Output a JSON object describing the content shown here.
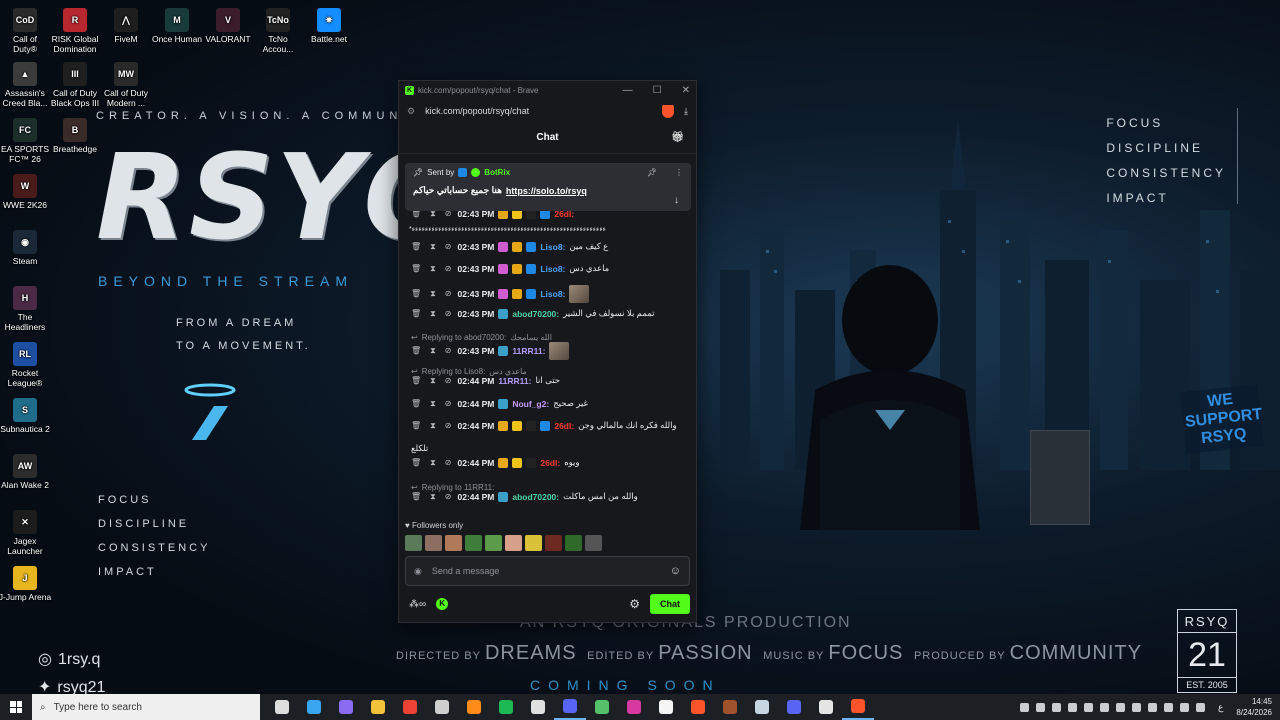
{
  "desktop": {
    "icons": [
      {
        "label": "Call of\nDuty®",
        "color": "#2b2b2b",
        "glyph": "CoD"
      },
      {
        "label": "RISK Global\nDomination",
        "color": "#b7282e",
        "glyph": "R"
      },
      {
        "label": "FiveM",
        "color": "#1e1e1e",
        "glyph": "⋀"
      },
      {
        "label": "Once Human",
        "color": "#173a3a",
        "glyph": "M"
      },
      {
        "label": "VALORANT",
        "color": "#3b1d2a",
        "glyph": "V"
      },
      {
        "label": "TcNo\nAccou...",
        "color": "#222",
        "glyph": "TcNo"
      },
      {
        "label": "Battle.net",
        "color": "#148eff",
        "glyph": "✷"
      },
      {
        "label": "Assassin's\nCreed Bla...",
        "color": "#3b3b3b",
        "glyph": "▲"
      },
      {
        "label": "Call of Duty\nBlack Ops III",
        "color": "#1f1f1f",
        "glyph": "III"
      },
      {
        "label": "Call of Duty\nModern ...",
        "color": "#2a2a2a",
        "glyph": "MW"
      },
      {
        "label": "EA SPORTS\nFC™ 26",
        "color": "#1c2f2a",
        "glyph": "FC"
      },
      {
        "label": "Breathedge",
        "color": "#3a2a28",
        "glyph": "B"
      },
      {
        "label": "WWE 2K26",
        "color": "#4a1b1b",
        "glyph": "W"
      },
      {
        "label": "Steam",
        "color": "#1b2838",
        "glyph": "◉"
      },
      {
        "label": "The\nHeadliners",
        "color": "#4a2a45",
        "glyph": "H"
      },
      {
        "label": "Rocket\nLeague®",
        "color": "#1d4fa3",
        "glyph": "RL"
      },
      {
        "label": "Subnautica 2",
        "color": "#1f6d8a",
        "glyph": "S"
      },
      {
        "label": "Alan Wake 2",
        "color": "#2c2c2c",
        "glyph": "AW"
      },
      {
        "label": "Jagex\nLauncher",
        "color": "#1c1c1c",
        "glyph": "✕"
      },
      {
        "label": "J-Jump Arena",
        "color": "#e7b51e",
        "glyph": "J"
      }
    ]
  },
  "wallpaper": {
    "tagline_top": "CREATOR. A VISION. A COMMUNITY",
    "logo": "RSYQ",
    "subtitle": "BEYOND THE STREAM",
    "dream_line1": "FROM A DREAM",
    "dream_line2": "TO A MOVEMENT.",
    "values": [
      "FOCUS",
      "DISCIPLINE",
      "CONSISTENCY",
      "IMPACT"
    ],
    "instagram": "1rsy.q",
    "twitter": "rsyq21",
    "production": "AN RSYQ ORIGINALS PRODUCTION",
    "credits": {
      "directed_label": "DIRECTED BY",
      "directed": "DREAMS",
      "edited_label": "EDITED BY",
      "edited": "PASSION",
      "music_label": "MUSIC BY",
      "music": "FOCUS",
      "produced_label": "PRODUCED BY",
      "produced": "COMMUNITY"
    },
    "coming_soon": "COMING SOON",
    "support_line1": "WE",
    "support_line2": "SUPPORT",
    "support_line3": "RSYQ",
    "badge_top": "RSYQ",
    "badge_num": "21",
    "badge_est": "EST. 2005"
  },
  "browser": {
    "title": "kick.com/popout/rsyq/chat - Brave",
    "url": "kick.com/popout/rsyq/chat",
    "minimize": "—",
    "maximize": "☐",
    "close": "✕"
  },
  "chat": {
    "header": "Chat",
    "pinned": {
      "sent_by": "Sent by",
      "user": "BotRix",
      "text": "هنا جميع حساباتي حياكم",
      "link": "https://solo.to/rsyq"
    },
    "messages": [
      {
        "time": "02:43 PM",
        "user": "26dl:",
        "user_color": "#ff3b30",
        "text": "",
        "badges": [
          "#e6a817",
          "#f0c419",
          "#222",
          "#1e88e5"
        ]
      },
      {
        "time": "02:43 PM",
        "user": "Liso8:",
        "user_color": "#4aa3ff",
        "text": "ع كيف مين",
        "badges": [
          "#d05cd0",
          "#e6a817",
          "#1e88e5"
        ]
      },
      {
        "time": "02:43 PM",
        "user": "Liso8:",
        "user_color": "#4aa3ff",
        "text": "ماعدي دس",
        "badges": [
          "#d05cd0",
          "#e6a817",
          "#1e88e5"
        ]
      },
      {
        "time": "02:43 PM",
        "user": "Liso8:",
        "user_color": "#4aa3ff",
        "text": "",
        "badges": [
          "#d05cd0",
          "#e6a817",
          "#1e88e5"
        ]
      },
      {
        "time": "02:43 PM",
        "user": "abod70200:",
        "user_color": "#4cd4a5",
        "text": "تممم بلا نسولف في الشير",
        "badges": [
          "#3aa0c8"
        ]
      },
      {
        "time": "02:43 PM",
        "user": "11RR11:",
        "user_color": "#b39dff",
        "text": "",
        "badges": [
          "#3aa0c8"
        ]
      },
      {
        "time": "02:44 PM",
        "user": "11RR11:",
        "user_color": "#b39dff",
        "text": "حتى انا",
        "badges": []
      },
      {
        "time": "02:44 PM",
        "user": "Nouf_g2:",
        "user_color": "#c89bff",
        "text": "غير صحيح",
        "badges": [
          "#3aa0c8"
        ]
      },
      {
        "time": "02:44 PM",
        "user": "26dl:",
        "user_color": "#ff3b30",
        "text": "والله فكره انك مالمالي وجن",
        "badges": [
          "#e6a817",
          "#f0c419",
          "#222",
          "#1e88e5"
        ]
      },
      {
        "time": "02:44 PM",
        "user": "26dl:",
        "user_color": "#ff3b30",
        "text": "ويوه",
        "badges": [
          "#e6a817",
          "#f0c419",
          "#222"
        ]
      },
      {
        "time": "02:44 PM",
        "user": "abod70200:",
        "user_color": "#4cd4a5",
        "text": "والله من امس ماكلت",
        "badges": [
          "#3aa0c8"
        ]
      }
    ],
    "spam_line": "*ءءءءءءءءءءءءءءءءءءءءءءءءءءءءءءءءءءءءءءءءءءءءءءءءءءءءءءءءءءء",
    "wrap_line": "تلكلع",
    "replies": {
      "r1": "Replying to abod70200:",
      "r1_text": "الله يسامحك",
      "r2": "Replying to Liso8:",
      "r2_text": "ماعدي دس",
      "r3": "Replying to 11RR11:"
    },
    "followers_only": "Followers only",
    "placeholder": "Send a message",
    "send_button": "Chat"
  },
  "taskbar": {
    "search_placeholder": "Type here to search",
    "language": "ع",
    "time": "14:45",
    "date": "8/24/2026"
  }
}
